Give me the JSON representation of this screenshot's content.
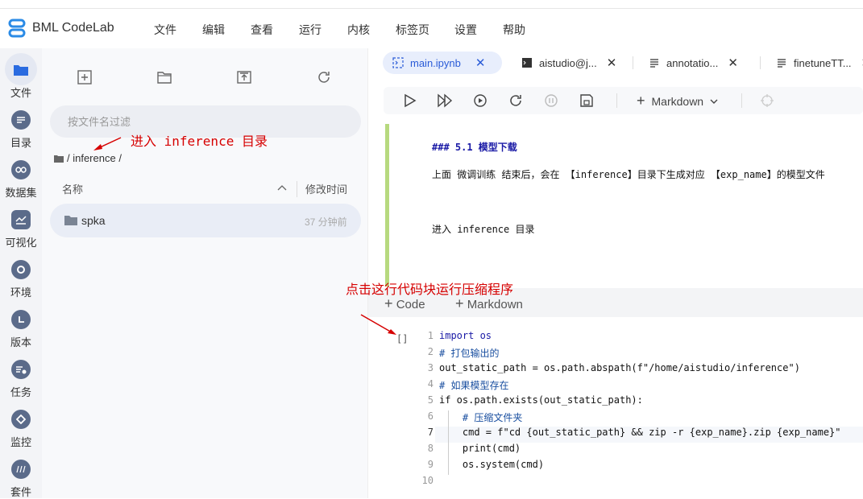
{
  "app": {
    "title": "BML CodeLab"
  },
  "menu": [
    "文件",
    "编辑",
    "查看",
    "运行",
    "内核",
    "标签页",
    "设置",
    "帮助"
  ],
  "leftbar": [
    "文件",
    "目录",
    "数据集",
    "可视化",
    "环境",
    "版本",
    "任务",
    "监控",
    "套件"
  ],
  "filepanel": {
    "filter_placeholder": "按文件名过滤",
    "breadcrumb": "/ inference /",
    "col_name": "名称",
    "col_modified": "修改时间",
    "rows": [
      {
        "name": "spka",
        "modified": "37 分钟前"
      }
    ]
  },
  "tabs": [
    {
      "label": "main.ipynb",
      "active": true
    },
    {
      "label": "aistudio@j...",
      "active": false
    },
    {
      "label": "annotatio...",
      "active": false
    },
    {
      "label": "finetuneTT...",
      "active": false
    }
  ],
  "toolbar": {
    "cell_type": "Markdown"
  },
  "markdown_cell": {
    "heading": "### 5.1 模型下载",
    "para1": "上面 微调训练 结束后，会在 【inference】目录下生成对应 【exp_name】的模型文件",
    "para2": "进入 inference 目录"
  },
  "addbar": {
    "code": "Code",
    "markdown": "Markdown"
  },
  "code_cell": {
    "prompt": "[]",
    "lines": [
      "import os",
      "# 打包输出的",
      "out_static_path = os.path.abspath(f\"/home/aistudio/inference\")",
      "# 如果模型存在",
      "if os.path.exists(out_static_path):",
      "    # 压缩文件夹",
      "    cmd = f\"cd {out_static_path} && zip -r {exp_name}.zip {exp_name}\"",
      "    print(cmd)",
      "    os.system(cmd)",
      ""
    ]
  },
  "annotations": {
    "enter_dir": "进入 inference 目录",
    "run_cell": "点击这行代码块运行压缩程序"
  },
  "colors": {
    "accent": "#2a5bd7",
    "annotation": "#d60000",
    "md_bar": "#b7d97f"
  }
}
